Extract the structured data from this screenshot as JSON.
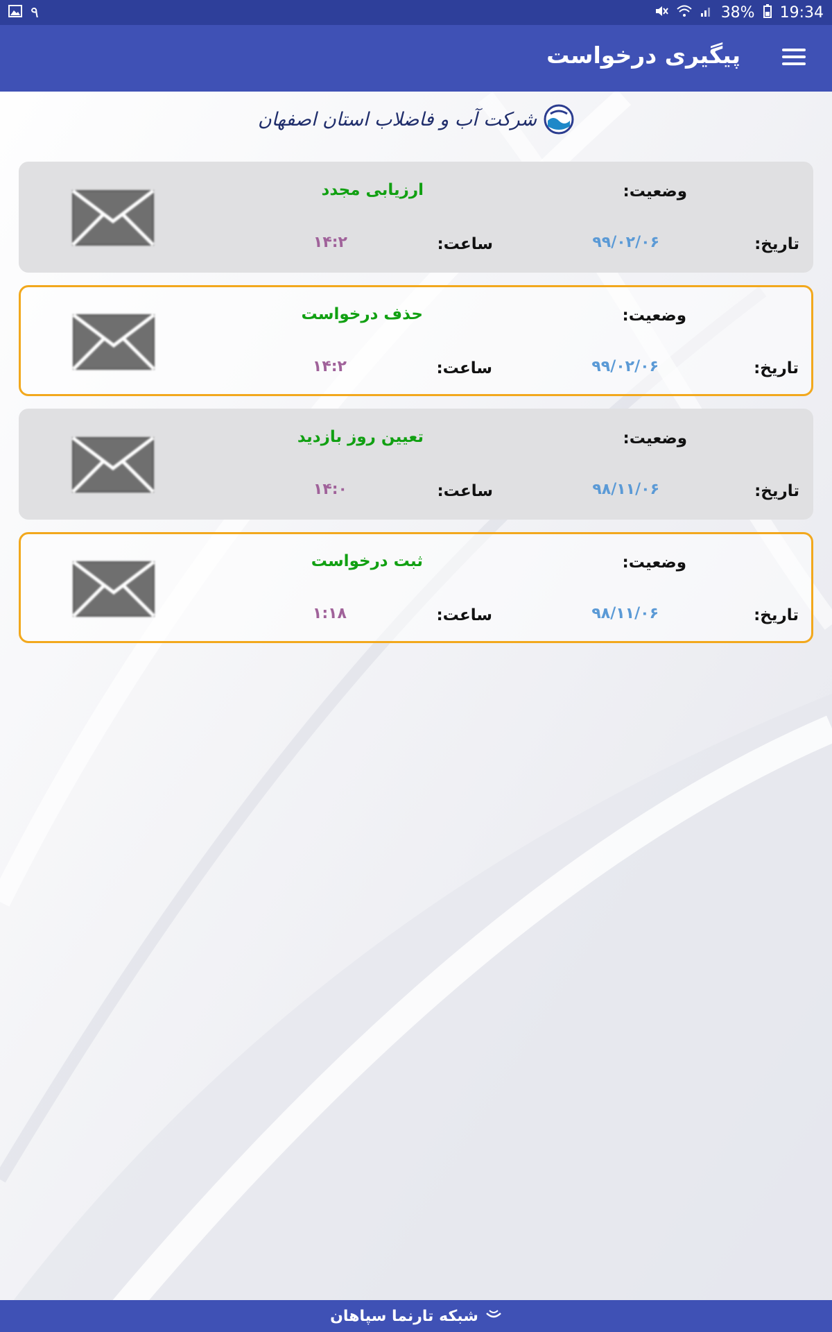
{
  "status_bar": {
    "left_number": "۹",
    "battery": "38%",
    "time": "19:34",
    "icons": [
      "image-icon",
      "mute-icon",
      "wifi-icon",
      "signal-icon",
      "battery-icon"
    ]
  },
  "app_bar": {
    "title": "پیگیری درخواست",
    "menu_icon": "hamburger-menu-icon",
    "color": "#3f51b5"
  },
  "logo": {
    "text": "شرکت آب و فاضلاب استان اصفهان",
    "icon": "water-company-logo-icon"
  },
  "labels": {
    "status": "وضعیت:",
    "date": "تاریخ:",
    "time": "ساعت:"
  },
  "requests": [
    {
      "status": "ارزیابی مجدد",
      "date": "۹۹/۰۲/۰۶",
      "time": "۱۴:۲",
      "style": "filled"
    },
    {
      "status": "حذف درخواست",
      "date": "۹۹/۰۲/۰۶",
      "time": "۱۴:۲",
      "style": "outlined"
    },
    {
      "status": "تعیین روز بازدید",
      "date": "۹۸/۱۱/۰۶",
      "time": "۱۴:۰",
      "style": "filled"
    },
    {
      "status": "ثبت درخواست",
      "date": "۹۸/۱۱/۰۶",
      "time": "۱:۱۸",
      "style": "outlined"
    }
  ],
  "footer": {
    "text": "شبکه تارنما سپاهان",
    "icon": "network-logo-icon"
  },
  "colors": {
    "status_bar": "#2e3f9a",
    "status_value": "#11a012",
    "date_value": "#5b9ad6",
    "time_value": "#a0629a",
    "highlight_border": "#f2a81d",
    "card_fill": "#e0e0e2"
  }
}
